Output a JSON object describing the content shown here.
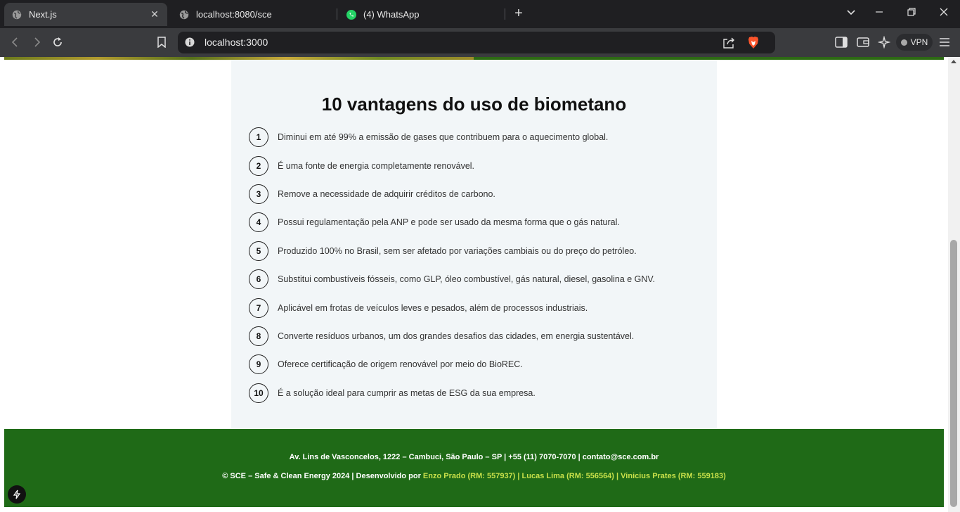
{
  "browser": {
    "tabs": [
      {
        "title": "Next.js",
        "active": true
      },
      {
        "title": "localhost:8080/sce",
        "active": false
      },
      {
        "title": "(4) WhatsApp",
        "active": false
      }
    ],
    "url": "localhost:3000",
    "vpn_label": "VPN"
  },
  "page": {
    "title": "10 vantagens do uso de biometano",
    "advantages": [
      {
        "num": "1",
        "text": "Diminui em até 99% a emissão de gases que contribuem para o aquecimento global."
      },
      {
        "num": "2",
        "text": "É uma fonte de energia completamente renovável."
      },
      {
        "num": "3",
        "text": "Remove a necessidade de adquirir créditos de carbono."
      },
      {
        "num": "4",
        "text": "Possui regulamentação pela ANP e pode ser usado da mesma forma que o gás natural."
      },
      {
        "num": "5",
        "text": "Produzido 100% no Brasil, sem ser afetado por variações cambiais ou do preço do petróleo."
      },
      {
        "num": "6",
        "text": "Substitui combustíveis fósseis, como GLP, óleo combustível, gás natural, diesel, gasolina e GNV."
      },
      {
        "num": "7",
        "text": "Aplicável em frotas de veículos leves e pesados, além de processos industriais."
      },
      {
        "num": "8",
        "text": "Converte resíduos urbanos, um dos grandes desafios das cidades, em energia sustentável."
      },
      {
        "num": "9",
        "text": "Oferece certificação de origem renovável por meio do BioREC."
      },
      {
        "num": "10",
        "text": "É a solução ideal para cumprir as metas de ESG da sua empresa."
      }
    ]
  },
  "footer": {
    "contact": "Av. Lins de Vasconcelos, 1222 – Cambuci, São Paulo – SP | +55 (11) 7070-7070 | contato@sce.com.br",
    "copyright": "© SCE – Safe & Clean Energy 2024 | Desenvolvido por ",
    "developers": "Enzo Prado (RM: 557937) | Lucas Lima (RM: 556564) | Vinicius Prates (RM: 559183)"
  },
  "colors": {
    "footer_bg": "#1f6a17",
    "highlight": "#c8e04a",
    "card_bg": "#f2f6f8"
  }
}
